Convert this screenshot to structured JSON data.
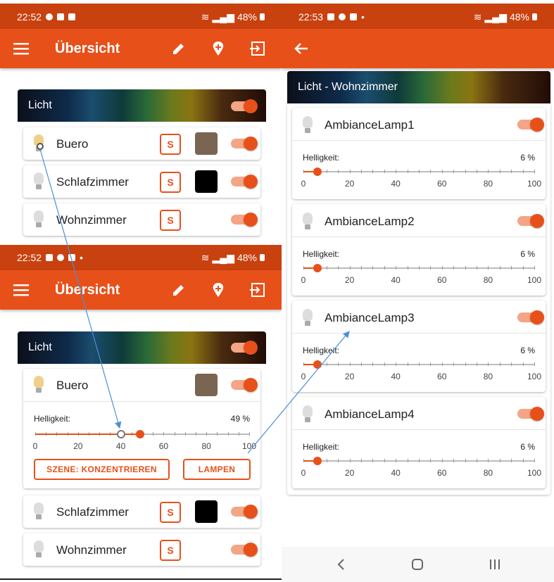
{
  "screens": {
    "top_left": {
      "status": {
        "time": "22:52",
        "battery": "48%"
      },
      "appbar": {
        "title": "Übersicht"
      },
      "group": {
        "title": "Licht"
      },
      "rooms": [
        {
          "name": "Buero",
          "scene_label": "S",
          "swatch": "#7a6553",
          "bulb_on": true
        },
        {
          "name": "Schlafzimmer",
          "scene_label": "S",
          "swatch": "#000000",
          "bulb_on": false
        },
        {
          "name": "Wohnzimmer",
          "scene_label": "S",
          "swatch": null,
          "bulb_on": false
        }
      ]
    },
    "bottom_left": {
      "status": {
        "time": "22:52",
        "battery": "48%"
      },
      "appbar": {
        "title": "Übersicht"
      },
      "group": {
        "title": "Licht"
      },
      "expanded_room": {
        "name": "Buero",
        "swatch": "#7a6553",
        "brightness_label": "Helligkeit:",
        "brightness_value": "49 %",
        "brightness": 49,
        "previous_brightness": 40,
        "scene_button": "SZENE: KONZENTRIEREN",
        "lamps_button": "LAMPEN",
        "ticks": [
          "0",
          "20",
          "40",
          "60",
          "80",
          "100"
        ]
      },
      "rooms": [
        {
          "name": "Schlafzimmer",
          "scene_label": "S",
          "swatch": "#000000"
        },
        {
          "name": "Wohnzimmer",
          "scene_label": "S",
          "swatch": null
        }
      ]
    },
    "right": {
      "status": {
        "time": "22:53",
        "battery": "48%"
      },
      "group": {
        "title": "Licht - Wohnzimmer"
      },
      "lamps": [
        {
          "name": "AmbianceLamp1",
          "brightness_label": "Helligkeit:",
          "brightness_value": "6 %",
          "brightness": 6
        },
        {
          "name": "AmbianceLamp2",
          "brightness_label": "Helligkeit:",
          "brightness_value": "6 %",
          "brightness": 6
        },
        {
          "name": "AmbianceLamp3",
          "brightness_label": "Helligkeit:",
          "brightness_value": "6 %",
          "brightness": 6
        },
        {
          "name": "AmbianceLamp4",
          "brightness_label": "Helligkeit:",
          "brightness_value": "6 %",
          "brightness": 6
        }
      ],
      "ticks": [
        "0",
        "20",
        "40",
        "60",
        "80",
        "100"
      ]
    }
  },
  "colors": {
    "accent": "#e8501a",
    "statusbar": "#c8410f",
    "track": "#f3a585",
    "arrow": "#4a8fd6"
  },
  "icons": [
    "menu-icon",
    "edit-icon",
    "add-location-icon",
    "logout-icon",
    "back-icon",
    "bulb-icon",
    "nav-back-icon",
    "nav-home-icon",
    "nav-recents-icon"
  ]
}
